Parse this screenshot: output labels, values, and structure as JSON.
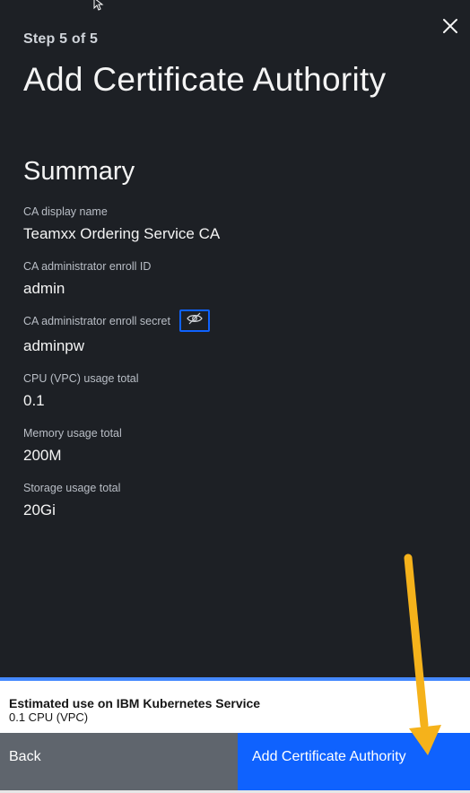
{
  "header": {
    "step": "Step 5 of 5",
    "title": "Add Certificate Authority"
  },
  "summary": {
    "heading": "Summary",
    "fields": [
      {
        "label": "CA display name",
        "value": "Teamxx Ordering Service CA"
      },
      {
        "label": "CA administrator enroll ID",
        "value": "admin"
      },
      {
        "label": "CA administrator enroll secret",
        "value": "adminpw"
      },
      {
        "label": "CPU (VPC) usage total",
        "value": "0.1"
      },
      {
        "label": "Memory usage total",
        "value": "200M"
      },
      {
        "label": "Storage usage total",
        "value": "20Gi"
      }
    ]
  },
  "estimate": {
    "title": "Estimated use on IBM Kubernetes Service",
    "value": "0.1 CPU (VPC)"
  },
  "actions": {
    "back": "Back",
    "primary": "Add Certificate Authority"
  },
  "icons": {
    "close": "close-icon",
    "toggle": "eye-slash-icon",
    "cursor": "mouse-pointer-icon"
  },
  "colors": {
    "panel_bg": "#1d2025",
    "primary": "#0f62fe",
    "secondary": "#5f656d",
    "annotation_arrow": "#f5b21b"
  }
}
